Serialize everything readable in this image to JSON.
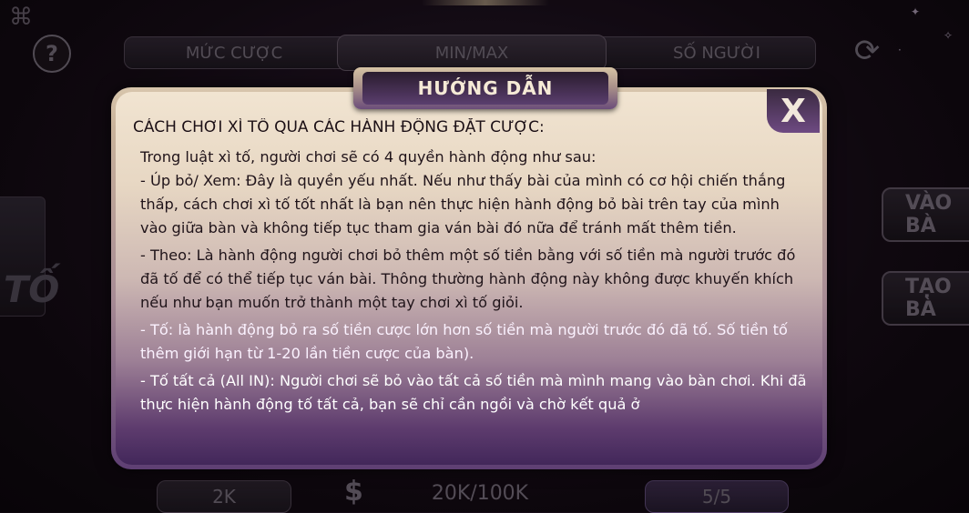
{
  "header": {
    "tabs": [
      "MỨC CƯỢC",
      "MIN/MAX",
      "SỐ NGƯỜI"
    ]
  },
  "side_buttons": [
    "VÀO BÀ",
    "TẠO BÀ"
  ],
  "left_decor": "TỐ",
  "bottom_row": {
    "bet": "2K",
    "minmax": "20K/100K",
    "players": "5/5"
  },
  "modal": {
    "title": "HƯỚNG DẪN",
    "close": "X",
    "heading": "CÁCH CHƠI XÌ TỐ QUA CÁC HÀNH ĐỘNG ĐẶT CƯỢC:",
    "paragraphs": [
      "Trong luật xì tố, người chơi sẽ có 4 quyền hành động như sau:",
      "- Úp bỏ/ Xem: Đây là quyền yếu nhất. Nếu như thấy bài của mình có cơ hội chiến thắng thấp, cách chơi xì tố tốt nhất là bạn nên thực hiện hành động bỏ bài trên tay của mình vào giữa bàn và không tiếp tục tham gia ván bài đó nữa để tránh mất thêm tiền.",
      "- Theo: Là hành động người chơi bỏ thêm một số tiền bằng với số tiền mà người trước đó đã tố để có thể tiếp tục ván bài. Thông thường hành động này không được khuyến khích nếu như bạn muốn trở thành một tay chơi xì tố giỏi.",
      "- Tố: là hành động bỏ ra số tiền cược lớn hơn số tiền mà người trước đó đã tố. Số tiền tố thêm giới hạn từ 1-20 lần tiền cược của bàn).",
      "- Tố tất cả (All IN): Người chơi sẽ bỏ vào tất cả số tiền mà mình mang vào bàn chơi. Khi đã thực hiện hành động tố tất cả, bạn sẽ chỉ cần ngồi và chờ kết quả ở"
    ]
  }
}
